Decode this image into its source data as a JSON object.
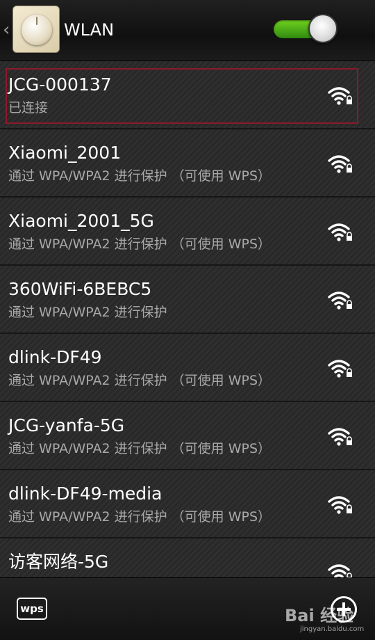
{
  "header": {
    "back_glyph": "‹",
    "title": "WLAN",
    "toggle_state": "on",
    "toggle_color": "#4db51a"
  },
  "networks": [
    {
      "name": "JCG-000137",
      "status": "已连接",
      "secured": true,
      "selected": true
    },
    {
      "name": "Xiaomi_2001",
      "status": "通过 WPA/WPA2 进行保护 （可使用 WPS）",
      "secured": true
    },
    {
      "name": "Xiaomi_2001_5G",
      "status": "通过 WPA/WPA2 进行保护 （可使用 WPS）",
      "secured": true
    },
    {
      "name": "360WiFi-6BEBC5",
      "status": "通过 WPA/WPA2 进行保护",
      "secured": true
    },
    {
      "name": "dlink-DF49",
      "status": "通过 WPA/WPA2 进行保护 （可使用 WPS）",
      "secured": true
    },
    {
      "name": "JCG-yanfa-5G",
      "status": "通过 WPA/WPA2 进行保护 （可使用 WPS）",
      "secured": true
    },
    {
      "name": "dlink-DF49-media",
      "status": "通过 WPA/WPA2 进行保护 （可使用 WPS）",
      "secured": true
    },
    {
      "name": "访客网络-5G",
      "status": "",
      "secured": true
    }
  ],
  "bottom_bar": {
    "wps_label": "wps",
    "add_icon": "add-network-icon",
    "watermark_brand": "Bai 经验",
    "watermark_domain": "jingyan.baidu.com"
  },
  "colors": {
    "selected_outline": "#8b1a2b",
    "status_text": "#a9a9a9"
  }
}
